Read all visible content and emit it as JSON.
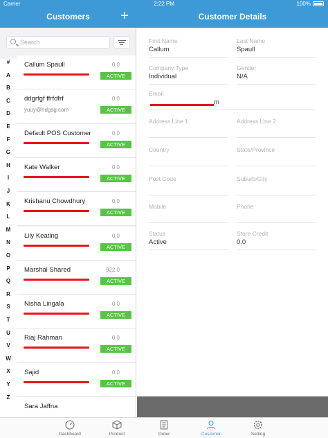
{
  "status_bar": {
    "carrier": "Carrier",
    "time": "2:22 PM",
    "battery": "100%"
  },
  "left_header": {
    "title": "Customers",
    "add_label": "+"
  },
  "right_header": {
    "title": "Customer Details"
  },
  "search": {
    "placeholder": "Search"
  },
  "index_letters": [
    "#",
    "A",
    "B",
    "C",
    "D",
    "E",
    "F",
    "G",
    "H",
    "I",
    "J",
    "K",
    "L",
    "M",
    "N",
    "O",
    "P",
    "Q",
    "R",
    "S",
    "T",
    "U",
    "V",
    "W",
    "X",
    "Y",
    "Z"
  ],
  "customers": [
    {
      "name": "Callum Spaull",
      "sub": "",
      "amount": "0.0",
      "status": "ACTIVE"
    },
    {
      "name": "ddgrfgf ffrfdfrf",
      "sub": "yuuy@hdgsg.com",
      "amount": "0.0",
      "status": "ACTIVE"
    },
    {
      "name": "Default POS Customer",
      "sub": "",
      "amount": "0.0",
      "status": "ACTIVE"
    },
    {
      "name": "Kate Walker",
      "sub": "",
      "amount": "0.0",
      "status": "ACTIVE"
    },
    {
      "name": "Krishanu Chowdhury",
      "sub": "",
      "amount": "0.0",
      "status": "ACTIVE"
    },
    {
      "name": "Lily Keating",
      "sub": "",
      "amount": "0.0",
      "status": "ACTIVE"
    },
    {
      "name": "Marshal Shared",
      "sub": "",
      "amount": "922.0",
      "status": "ACTIVE"
    },
    {
      "name": "Nisha Lingala",
      "sub": "",
      "amount": "0.0",
      "status": "ACTIVE"
    },
    {
      "name": "Riaj Rahman",
      "sub": "",
      "amount": "0.0",
      "status": "ACTIVE"
    },
    {
      "name": "Sajid",
      "sub": "",
      "amount": "0.0",
      "status": "ACTIVE"
    },
    {
      "name": "Sara Jaffna",
      "sub": "",
      "amount": "",
      "status": ""
    }
  ],
  "details": {
    "first_name": {
      "label": "First Name",
      "value": "Callum"
    },
    "last_name": {
      "label": "Last Name",
      "value": "Spaull"
    },
    "company_type": {
      "label": "Company Type",
      "value": "Individual"
    },
    "gender": {
      "label": "Gender",
      "value": "N/A"
    },
    "email": {
      "label": "Email",
      "value": "m"
    },
    "address1": {
      "label": "Address Line 1",
      "value": ""
    },
    "address2": {
      "label": "Address Line 2",
      "value": ""
    },
    "country": {
      "label": "Country",
      "value": ""
    },
    "state": {
      "label": "State/Province",
      "value": ""
    },
    "post_code": {
      "label": "Post Code",
      "value": ""
    },
    "suburb": {
      "label": "Suburb/City",
      "value": ""
    },
    "mobile": {
      "label": "Mobile",
      "value": ""
    },
    "phone": {
      "label": "Phone",
      "value": ""
    },
    "status": {
      "label": "Status",
      "value": "Active"
    },
    "store_credit": {
      "label": "Store Credit",
      "value": "0.0"
    }
  },
  "tabs": [
    {
      "label": "Dashboard",
      "icon": "speedometer-icon"
    },
    {
      "label": "Product",
      "icon": "box-icon"
    },
    {
      "label": "Order",
      "icon": "document-icon"
    },
    {
      "label": "Customer",
      "icon": "person-icon",
      "active": true
    },
    {
      "label": "Setting",
      "icon": "gear-icon"
    }
  ],
  "colors": {
    "accent": "#3d9ad6",
    "active_badge": "#58c445",
    "redaction": "#e8141b"
  }
}
